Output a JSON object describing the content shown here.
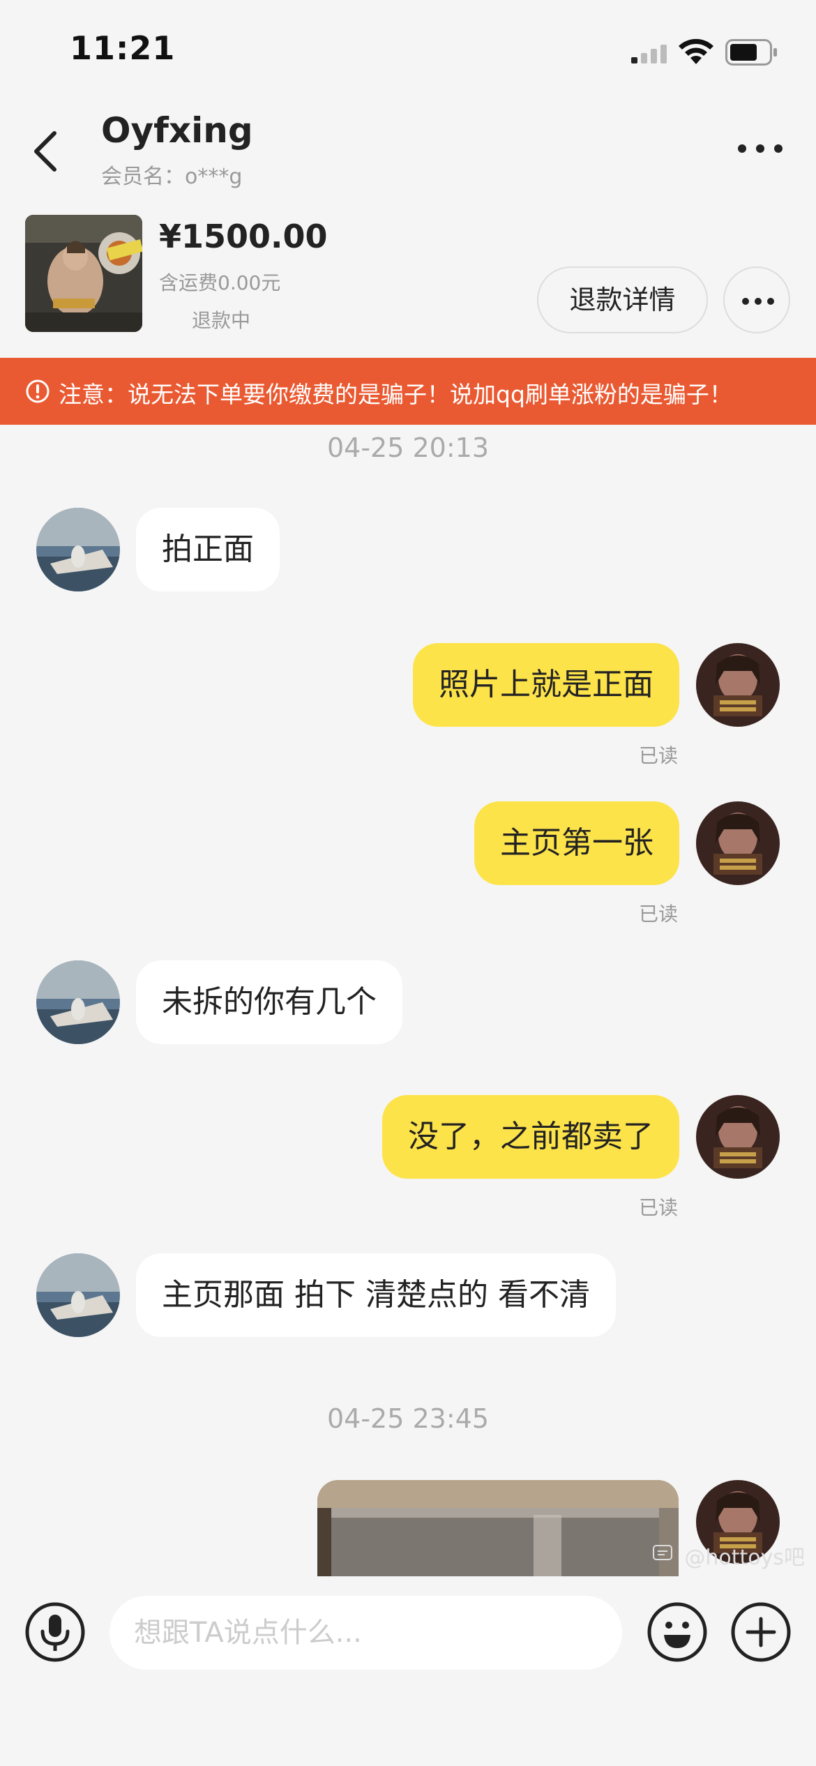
{
  "status_bar": {
    "time": "11:21"
  },
  "header": {
    "contact_name": "Oyfxing",
    "member_label": "会员名：o***g"
  },
  "product": {
    "price": "¥1500.00",
    "shipping": "含运费0.00元",
    "status": "退款中",
    "refund_button": "退款详情"
  },
  "warning": {
    "text": "注意：说无法下单要你缴费的是骗子！说加qq刷单涨粉的是骗子！"
  },
  "chat": {
    "timestamp_1": "04-25 20:13",
    "timestamp_2": "04-25 23:45",
    "messages": [
      {
        "side": "in",
        "text": "拍正面"
      },
      {
        "side": "out",
        "text": "照片上就是正面",
        "status": "已读"
      },
      {
        "side": "out",
        "text": "主页第一张",
        "status": "已读"
      },
      {
        "side": "in",
        "text": "未拆的你有几个"
      },
      {
        "side": "out",
        "text": "没了，之前都卖了",
        "status": "已读"
      },
      {
        "side": "in",
        "text": "主页那面 拍下 清楚点的 看不清"
      }
    ]
  },
  "input_bar": {
    "placeholder": "想跟TA说点什么..."
  },
  "watermark": "@hottoys吧",
  "colors": {
    "accent_warning": "#ea5a32",
    "outgoing_bubble": "#fde34a",
    "incoming_bubble": "#ffffff"
  },
  "icons": [
    "back-icon",
    "more-icon",
    "warning-icon",
    "microphone-icon",
    "emoji-icon",
    "plus-icon"
  ]
}
